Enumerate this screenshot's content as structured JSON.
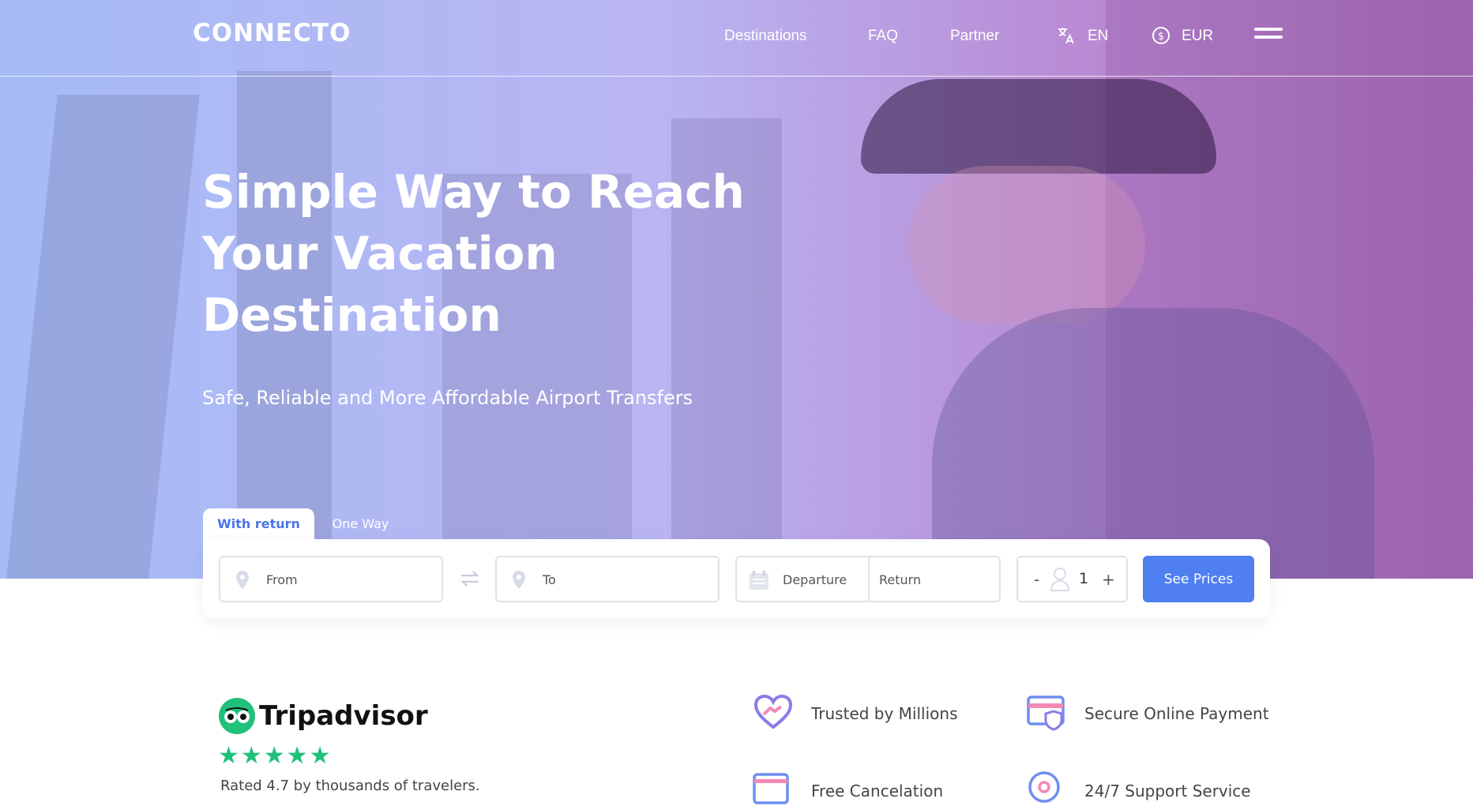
{
  "brand": {
    "logo": "CONNECTO"
  },
  "nav": {
    "links": [
      "Destinations",
      "FAQ",
      "Partner"
    ],
    "language": "EN",
    "currency": "EUR"
  },
  "hero": {
    "title": "Simple Way to Reach Your Vacation Destination",
    "subtitle": "Safe, Reliable and More Affordable Airport Transfers"
  },
  "search": {
    "tabs": [
      {
        "label": "With return",
        "active": true
      },
      {
        "label": "One Way",
        "active": false
      }
    ],
    "from_placeholder": "From",
    "to_placeholder": "To",
    "departure_placeholder": "Departure",
    "return_placeholder": "Return",
    "passengers": {
      "minus": "-",
      "value": "1",
      "plus": "+"
    },
    "submit_label": "See Prices"
  },
  "reviews": {
    "brand": "Tripadvisor",
    "stars": "★★★★★",
    "rating_text": "Rated 4.7 by thousands of travelers."
  },
  "features": [
    {
      "label": "Trusted by Millions",
      "icon": "heart-hands-icon"
    },
    {
      "label": "Secure Online Payment",
      "icon": "secure-card-icon"
    },
    {
      "label": "Free Cancelation",
      "icon": "calendar-icon"
    },
    {
      "label": "24/7 Support Service",
      "icon": "support-icon"
    }
  ],
  "colors": {
    "accent": "#4f7ff0",
    "tripadvisor": "#21c07b"
  }
}
